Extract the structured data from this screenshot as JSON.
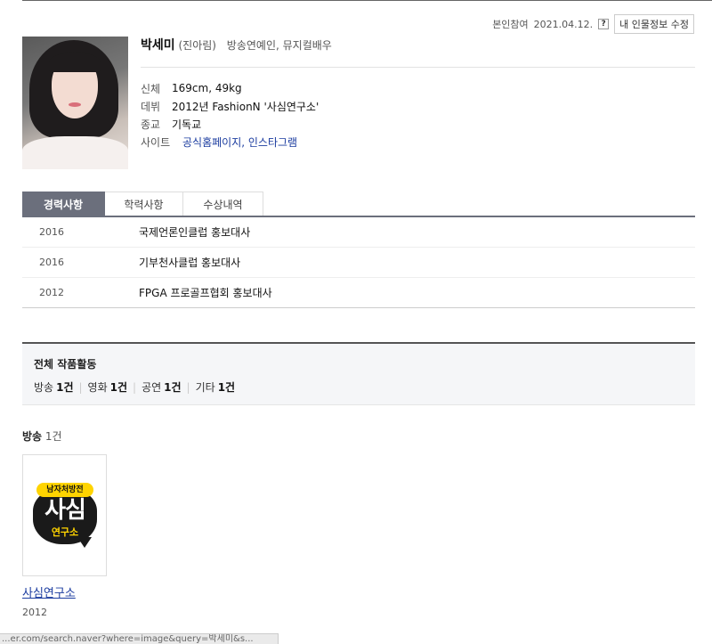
{
  "meta": {
    "verified_label": "본인참여",
    "date": "2021.04.12.",
    "help_glyph": "?",
    "edit_button": "내 인물정보 수정"
  },
  "profile": {
    "name": "박세미",
    "alias": "(진아림)",
    "occupation": "방송연예인, 뮤지컬배우",
    "info": [
      {
        "label": "신체",
        "value": "169cm, 49kg"
      },
      {
        "label": "데뷔",
        "value": "2012년 FashionN '사심연구소'"
      },
      {
        "label": "종교",
        "value": "기독교"
      },
      {
        "label": "사이트",
        "links": [
          "공식홈페이지",
          "인스타그램"
        ],
        "separator": ", "
      }
    ]
  },
  "tabs": [
    {
      "label": "경력사항",
      "active": true
    },
    {
      "label": "학력사항",
      "active": false
    },
    {
      "label": "수상내역",
      "active": false
    }
  ],
  "career": [
    {
      "year": "2016",
      "desc": "국제언론인클럽 홍보대사"
    },
    {
      "year": "2016",
      "desc": "기부천사클럽 홍보대사"
    },
    {
      "year": "2012",
      "desc": "FPGA 프로골프협회 홍보대사"
    }
  ],
  "works": {
    "title": "전체 작품활동",
    "categories": [
      {
        "label": "방송",
        "count": "1건"
      },
      {
        "label": "영화",
        "count": "1건"
      },
      {
        "label": "공연",
        "count": "1건"
      },
      {
        "label": "기타",
        "count": "1건"
      }
    ],
    "separator": "|"
  },
  "broadcast": {
    "heading": "방송",
    "count": "1건",
    "shows": [
      {
        "title": "사심연구소",
        "year": "2012",
        "logo_tag": "남자처방전",
        "logo_main": "사심",
        "logo_sub": "연구소"
      }
    ]
  },
  "status_bar": {
    "url": "...er.com/search.naver?where=image&query=박세미&s..."
  },
  "colors": {
    "tab_active_bg": "#6b6f7c",
    "link": "#1a3b9f",
    "logo_yellow": "#ffd400"
  }
}
